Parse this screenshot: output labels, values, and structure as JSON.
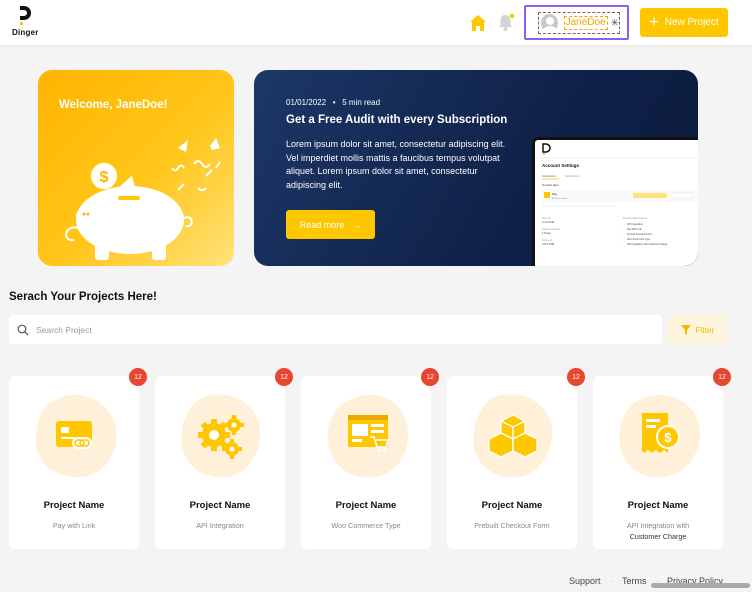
{
  "header": {
    "logo_text": "Dinger",
    "username": "JaneDoe",
    "new_project_label": "New Project"
  },
  "welcome": {
    "text": "Welcome, JaneDoe!"
  },
  "promo": {
    "date": "01/01/2022",
    "read_time": "5 min read",
    "title": "Get a Free Audit with every Subscription",
    "body": "Lorem ipsum dolor sit amet, consectetur adipiscing elit. Vel imperdiet mollis mattis a faucibus tempus volutpat aliquet. Lorem ipsum dolor sit amet, consectetur adipiscing elit.",
    "read_more_label": "Read more",
    "screen": {
      "title": "Account Settings",
      "tabs": [
        "Subscription",
        "Subscription"
      ],
      "section": "Current plan",
      "plan": "Pay",
      "plan_price": "$100 per month",
      "field1_label": "Next bill",
      "field1_value": "12 Jul 2022",
      "field2_label": "Payment method",
      "field2_value": "4 Dinger",
      "field3_label": "Card end",
      "field3_value": "XXXX 3456",
      "features_title": "Premium plan features",
      "features": [
        "API Integration",
        "Pay With Link",
        "Prebuilt Checkout Form",
        "Woo Commerce Type",
        "API Integration with Customer Charge"
      ]
    }
  },
  "search": {
    "title": "Serach Your Projects Here!",
    "placeholder": "Search Project",
    "filter_label": "Filter"
  },
  "projects": [
    {
      "badge": "12",
      "name": "Project Name",
      "subtitle": "Pay with Link",
      "subtitle2": ""
    },
    {
      "badge": "12",
      "name": "Project Name",
      "subtitle": "API Integration",
      "subtitle2": ""
    },
    {
      "badge": "12",
      "name": "Project Name",
      "subtitle": "Woo Commerce Type",
      "subtitle2": ""
    },
    {
      "badge": "12",
      "name": "Project Name",
      "subtitle": "Prebuilt Checkout Form",
      "subtitle2": ""
    },
    {
      "badge": "12",
      "name": "Project Name",
      "subtitle": "API Integration with",
      "subtitle2": "Customer Charge"
    }
  ],
  "footer": {
    "support": "Support",
    "terms": "Terms",
    "privacy": "Privacy Policy"
  },
  "colors": {
    "accent": "#ffc700",
    "navy": "#0f2148",
    "badge": "#e8462f",
    "highlight": "#8b5cf6"
  },
  "icons": [
    "home-icon",
    "bell-icon",
    "spinner-icon",
    "plus-icon",
    "arrow-right-icon",
    "search-icon",
    "filter-icon",
    "card-link-icon",
    "gears-icon",
    "web-cart-icon",
    "cubes-icon",
    "invoice-coin-icon"
  ]
}
